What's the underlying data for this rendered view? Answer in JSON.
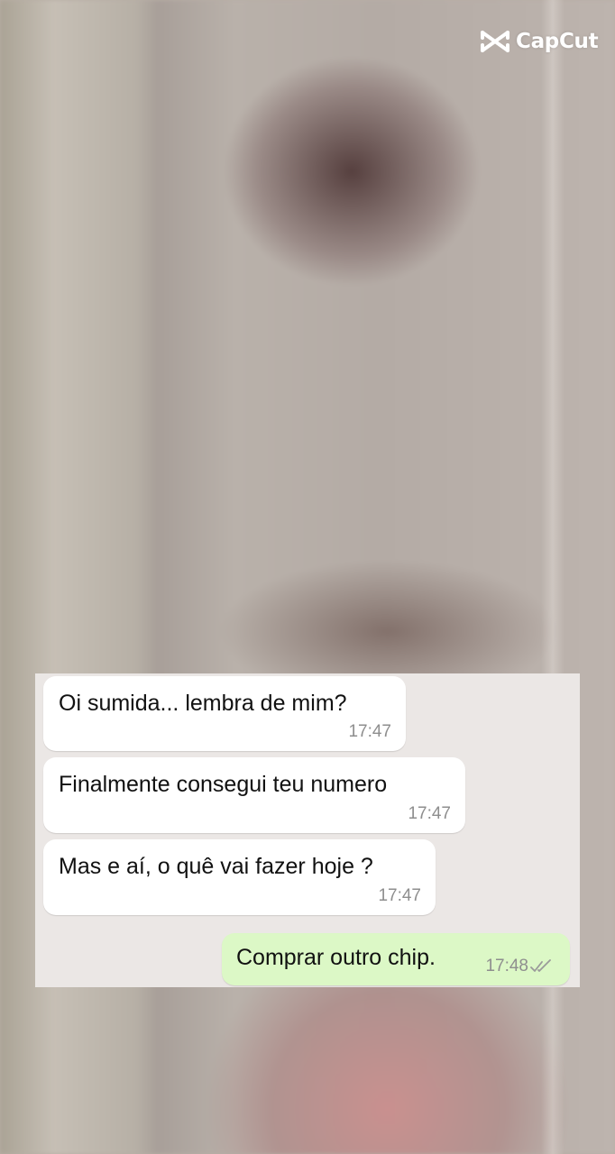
{
  "watermark": {
    "label": "CapCut",
    "icon": "capcut-logo-icon"
  },
  "chat": {
    "messages": [
      {
        "direction": "incoming",
        "text": "Oi sumida... lembra de mim?",
        "time": "17:47"
      },
      {
        "direction": "incoming",
        "text": "Finalmente consegui teu numero",
        "time": "17:47"
      },
      {
        "direction": "incoming",
        "text": "Mas e aí, o quê vai fazer hoje ?",
        "time": "17:47"
      },
      {
        "direction": "outgoing",
        "text": "Comprar outro chip.",
        "time": "17:48",
        "status_icon": "double-check-icon"
      }
    ]
  },
  "colors": {
    "incoming_bubble": "#ffffff",
    "outgoing_bubble": "#dcf8c6",
    "chat_background": "#ebe7e5",
    "timestamp": "#8e8e8e"
  }
}
